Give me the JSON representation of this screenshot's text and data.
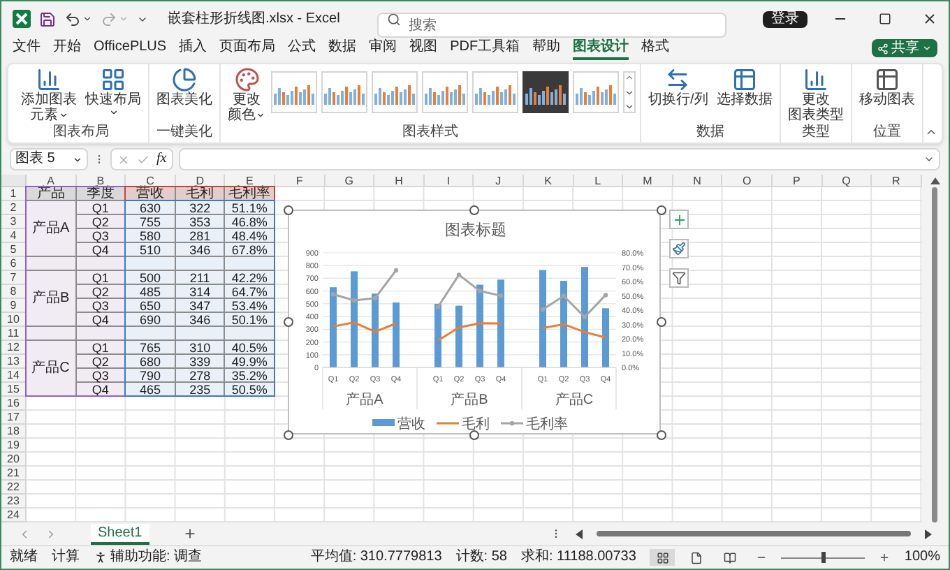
{
  "title_bar": {
    "filename": "嵌套柱形折线图.xlsx - Excel",
    "search_placeholder": "搜索",
    "sign_in": "登录"
  },
  "menu_tabs": [
    {
      "label": "文件",
      "selected": false
    },
    {
      "label": "开始",
      "selected": false
    },
    {
      "label": "OfficePLUS",
      "selected": false
    },
    {
      "label": "插入",
      "selected": false
    },
    {
      "label": "页面布局",
      "selected": false
    },
    {
      "label": "公式",
      "selected": false
    },
    {
      "label": "数据",
      "selected": false
    },
    {
      "label": "审阅",
      "selected": false
    },
    {
      "label": "视图",
      "selected": false
    },
    {
      "label": "PDF工具箱",
      "selected": false
    },
    {
      "label": "帮助",
      "selected": false
    },
    {
      "label": "图表设计",
      "selected": true
    },
    {
      "label": "格式",
      "selected": false
    }
  ],
  "share_button": "共享",
  "ribbon": {
    "groups": [
      {
        "label": "图表布局",
        "buttons": [
          {
            "lines": [
              "添加图表",
              "元素"
            ],
            "dropdown": true
          },
          {
            "lines": [
              "快速布局"
            ],
            "dropdown": true
          }
        ]
      },
      {
        "label": "一键美化",
        "buttons": [
          {
            "lines": [
              "图表美化"
            ],
            "dropdown": false
          }
        ]
      },
      {
        "label": "图表样式",
        "buttons": [
          {
            "lines": [
              "更改",
              "颜色"
            ],
            "dropdown": true
          }
        ],
        "gallery": [
          {
            "kind": "light"
          },
          {
            "kind": "light"
          },
          {
            "kind": "light"
          },
          {
            "kind": "light"
          },
          {
            "kind": "light"
          },
          {
            "kind": "dark"
          },
          {
            "kind": "light"
          }
        ]
      },
      {
        "label": "数据",
        "buttons": [
          {
            "lines": [
              "切换行/列"
            ],
            "dropdown": false
          },
          {
            "lines": [
              "选择数据"
            ],
            "dropdown": false
          }
        ]
      },
      {
        "label": "类型",
        "buttons": [
          {
            "lines": [
              "更改",
              "图表类型"
            ],
            "dropdown": false
          }
        ]
      },
      {
        "label": "位置",
        "buttons": [
          {
            "lines": [
              "移动图表"
            ],
            "dropdown": false
          }
        ]
      }
    ]
  },
  "formula_bar": {
    "name_box": "图表 5",
    "function_label": "fx"
  },
  "sheet": {
    "columns": [
      "A",
      "B",
      "C",
      "D",
      "E",
      "F",
      "G",
      "H",
      "I",
      "J",
      "K",
      "L",
      "M",
      "N",
      "O",
      "P",
      "Q",
      "R"
    ],
    "row_numbers": [
      "1",
      "2",
      "3",
      "4",
      "5",
      "6",
      "7",
      "8",
      "9",
      "10",
      "11",
      "12",
      "13",
      "14",
      "15",
      "16",
      "17",
      "18",
      "19",
      "20",
      "21",
      "22",
      "23",
      "24"
    ],
    "header": [
      "产品",
      "季度",
      "营收",
      "毛利",
      "毛利率"
    ],
    "groups": [
      {
        "label": "产品A",
        "rows": [
          [
            "Q1",
            "630",
            "322",
            "51.1%"
          ],
          [
            "Q2",
            "755",
            "353",
            "46.8%"
          ],
          [
            "Q3",
            "580",
            "281",
            "48.4%"
          ],
          [
            "Q4",
            "510",
            "346",
            "67.8%"
          ]
        ]
      },
      {
        "label": "产品B",
        "rows": [
          [
            "Q1",
            "500",
            "211",
            "42.2%"
          ],
          [
            "Q2",
            "485",
            "314",
            "64.7%"
          ],
          [
            "Q3",
            "650",
            "347",
            "53.4%"
          ],
          [
            "Q4",
            "690",
            "346",
            "50.1%"
          ]
        ]
      },
      {
        "label": "产品C",
        "rows": [
          [
            "Q1",
            "765",
            "310",
            "40.5%"
          ],
          [
            "Q2",
            "680",
            "339",
            "49.9%"
          ],
          [
            "Q3",
            "790",
            "278",
            "35.2%"
          ],
          [
            "Q4",
            "465",
            "235",
            "50.5%"
          ]
        ]
      }
    ]
  },
  "chart": {
    "group_labels": [
      "产品A",
      "产品B",
      "产品C"
    ],
    "chart_data": {
      "type": "bar",
      "title": "图表标题",
      "categories": [
        "Q1",
        "Q2",
        "Q3",
        "Q4",
        "Q1",
        "Q2",
        "Q3",
        "Q4",
        "Q1",
        "Q2",
        "Q3",
        "Q4"
      ],
      "series": [
        {
          "name": "营收",
          "type": "bar",
          "color": "#5b9bd5",
          "values": [
            630,
            755,
            580,
            510,
            500,
            485,
            650,
            690,
            765,
            680,
            790,
            465
          ]
        },
        {
          "name": "毛利",
          "type": "line",
          "color": "#ed7d31",
          "values": [
            322,
            353,
            281,
            346,
            211,
            314,
            347,
            346,
            310,
            339,
            278,
            235
          ]
        },
        {
          "name": "毛利率",
          "type": "line",
          "color": "#a5a5a5",
          "axis": "y2",
          "marker": true,
          "values": [
            51.1,
            46.8,
            48.4,
            67.8,
            42.2,
            64.7,
            53.4,
            50.1,
            40.5,
            49.9,
            35.2,
            50.5
          ]
        }
      ],
      "grid": true,
      "legend": true,
      "ylim": [
        0,
        900
      ],
      "yticks": [
        {
          "value": 0,
          "label": "0"
        },
        {
          "value": 100,
          "label": "100"
        },
        {
          "value": 200,
          "label": "200"
        },
        {
          "value": 300,
          "label": "300"
        },
        {
          "value": 400,
          "label": "400"
        },
        {
          "value": 500,
          "label": "500"
        },
        {
          "value": 600,
          "label": "600"
        },
        {
          "value": 700,
          "label": "700"
        },
        {
          "value": 800,
          "label": "800"
        },
        {
          "value": 900,
          "label": "900"
        }
      ],
      "y2lim": [
        0,
        80
      ],
      "y2ticks": [
        {
          "value": 0,
          "label": "0.0%"
        },
        {
          "value": 10,
          "label": "10.0%"
        },
        {
          "value": 20,
          "label": "20.0%"
        },
        {
          "value": 30,
          "label": "30.0%"
        },
        {
          "value": 40,
          "label": "40.0%"
        },
        {
          "value": 50,
          "label": "50.0%"
        },
        {
          "value": 60,
          "label": "60.0%"
        },
        {
          "value": 70,
          "label": "70.0%"
        },
        {
          "value": 80,
          "label": "80.0%"
        }
      ]
    }
  },
  "sheet_tabs": [
    {
      "label": "Sheet1",
      "selected": true
    }
  ],
  "status_bar": {
    "left": [
      "就绪",
      "计算"
    ],
    "accessibility": "辅助功能: 调查",
    "stats": [
      "平均值: 310.7779813",
      "计数: 58",
      "求和: 11188.00733"
    ],
    "views": [
      {
        "selected": true
      },
      {
        "selected": false
      },
      {
        "selected": false
      }
    ],
    "zoom": {
      "level": 0.5,
      "reading": "100%"
    }
  }
}
